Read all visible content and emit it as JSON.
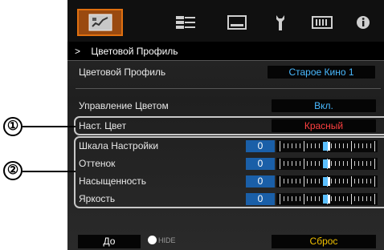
{
  "icons": [
    {
      "name": "picture-adjust-icon",
      "active": true
    },
    {
      "name": "input-signal-icon",
      "active": false
    },
    {
      "name": "display-setup-icon",
      "active": false
    },
    {
      "name": "installation-icon",
      "active": false
    },
    {
      "name": "function-icon",
      "active": false
    },
    {
      "name": "information-icon",
      "active": false
    }
  ],
  "header": {
    "arrow": ">",
    "title": "Цветовой Профиль"
  },
  "color_profile": {
    "label": "Цветовой Профиль",
    "value": "Старое Кино 1"
  },
  "color_management": {
    "label": "Управление Цветом",
    "value": "Вкл."
  },
  "pick_color": {
    "label": "Наст. Цвет",
    "value": "Красный"
  },
  "sliders": [
    {
      "label": "Шкала Настройки",
      "value": "0",
      "level": 0
    },
    {
      "label": "Оттенок",
      "value": "0",
      "level": 0
    },
    {
      "label": "Насыщенность",
      "value": "0",
      "level": 0
    },
    {
      "label": "Яркость",
      "value": "0",
      "level": 0
    }
  ],
  "footer": {
    "before": "До",
    "hide": "HIDE",
    "reset": "Сброс"
  },
  "callouts": {
    "one": "①",
    "two": "②"
  },
  "colors": {
    "accent_orange": "#e07010",
    "value_blue": "#49b9ff",
    "value_red": "#ff4040",
    "reset_yellow": "#f0c000"
  }
}
